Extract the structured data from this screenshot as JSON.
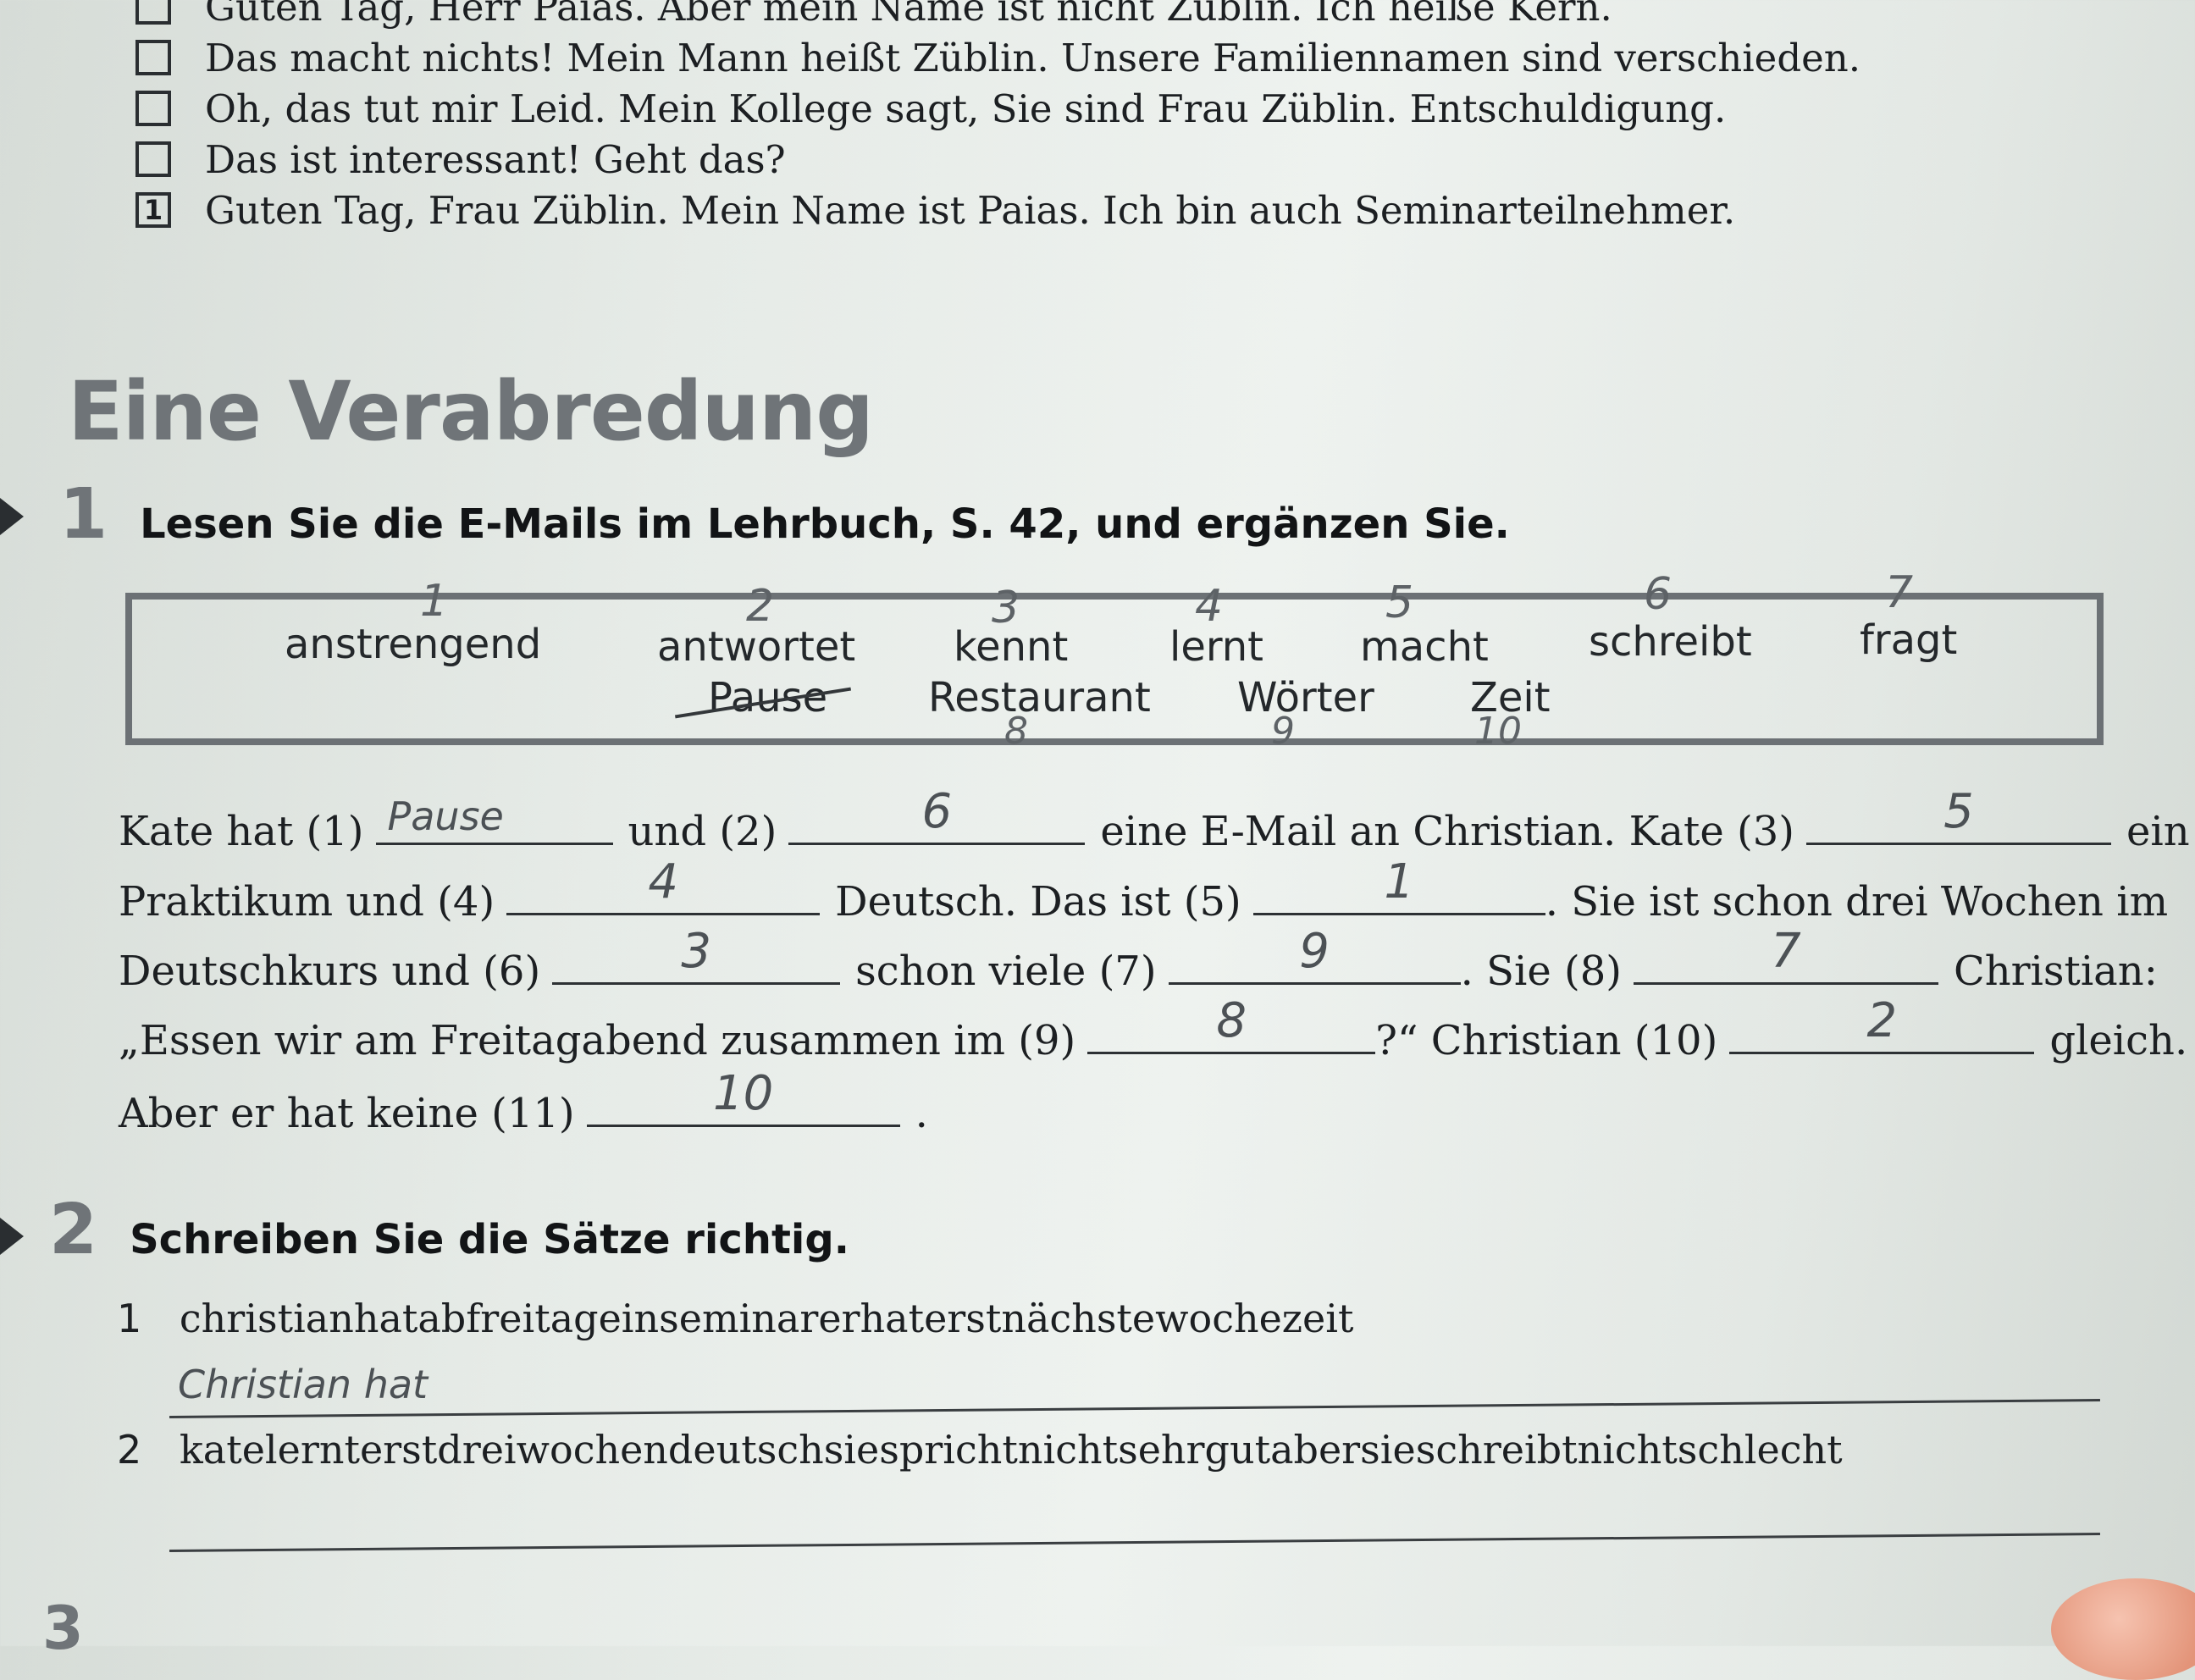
{
  "dialogue": [
    {
      "box": "",
      "text": "Guten Tag, Herr Paias. Aber mein Name ist nicht Züblin. Ich heiße Kern."
    },
    {
      "box": "",
      "text": "Das macht nichts! Mein Mann heißt Züblin. Unsere Familiennamen sind verschieden."
    },
    {
      "box": "",
      "text": "Oh, das tut mir Leid. Mein Kollege sagt, Sie sind Frau Züblin. Entschuldigung."
    },
    {
      "box": "",
      "text": "Das ist interessant! Geht das?"
    },
    {
      "box": "1",
      "text": "Guten Tag, Frau Züblin. Mein Name ist Paias. Ich bin auch Seminarteilnehmer."
    }
  ],
  "section_title": "Eine Verabredung",
  "exercise1": {
    "number": "1",
    "instruction": "Lesen Sie die E-Mails im Lehrbuch, S. 42, und ergänzen Sie.",
    "words_row1": [
      {
        "word": "anstrengend",
        "mark": "1"
      },
      {
        "word": "antwortet",
        "mark": "2"
      },
      {
        "word": "kennt",
        "mark": "3"
      },
      {
        "word": "lernt",
        "mark": "4"
      },
      {
        "word": "macht",
        "mark": "5"
      },
      {
        "word": "schreibt",
        "mark": "6"
      },
      {
        "word": "fragt",
        "mark": "7"
      }
    ],
    "words_row2": [
      {
        "word": "Pause",
        "mark": ""
      },
      {
        "word": "Restaurant",
        "mark": "8"
      },
      {
        "word": "Wörter",
        "mark": "9"
      },
      {
        "word": "Zeit",
        "mark": "10"
      }
    ],
    "text": {
      "l1_a": "Kate hat (1)",
      "a1": "Pause",
      "l1_b": "und (2)",
      "a2": "6",
      "l1_c": "eine E-Mail an Christian. Kate (3)",
      "a3": "5",
      "l1_d": "ein",
      "l2_a": "Praktikum und (4)",
      "a4": "4",
      "l2_b": "Deutsch. Das ist (5)",
      "a5": "1",
      "l2_c": ". Sie ist schon drei Wochen im",
      "l3_a": "Deutschkurs und (6)",
      "a6": "3",
      "l3_b": "schon viele (7)",
      "a7": "9",
      "l3_c": ". Sie (8)",
      "a8": "7",
      "l3_d": "Christian:",
      "l4_a": "„Essen wir am Freitagabend zusammen im (9)",
      "a9": "8",
      "l4_b": "?“ Christian (10)",
      "a10": "2",
      "l4_c": "gleich.",
      "l5_a": "Aber er hat keine (11)",
      "a11": "10",
      "l5_b": "."
    }
  },
  "exercise2": {
    "number": "2",
    "instruction": "Schreiben Sie die Sätze richtig.",
    "items": [
      {
        "n": "1",
        "text": "christianhatabfreitageinseminarerhaterstnächstewochezeit",
        "answer": "Christian hat"
      },
      {
        "n": "2",
        "text": "katelernterstdreiwochendeutschsiesprichtnichtsehrgutabersieschreibtnichtschlecht",
        "answer": ""
      }
    ]
  },
  "next_exercise_number": "3",
  "colors": {
    "paper": "#e6ebe7",
    "heading_gray": "#6f7478",
    "ink": "#1c1f22",
    "pencil": "#4c5155"
  }
}
